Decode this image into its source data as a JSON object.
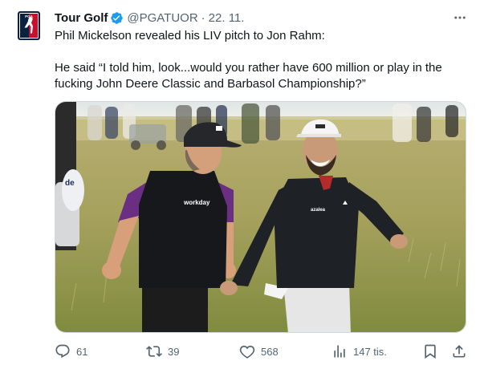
{
  "tweet": {
    "author": {
      "display_name": "Tour Golf",
      "handle": "@PGATUOR",
      "verified": true,
      "avatar_icon": "pga-tour-logo-icon",
      "avatar_text": "PGA TOUR"
    },
    "separator": "·",
    "date": "22. 11.",
    "text_lines": [
      "Phil Mickelson revealed his LIV pitch to Jon Rahm:",
      "He said “I told him, look...would you rather have 600 million or play in the fucking John Deere Classic and Barbasol Championship?”"
    ],
    "media_image_text": {
      "left_vest_logo": "workday",
      "right_jacket_logo": "azalea",
      "bag_text": "de"
    },
    "actions": {
      "reply_count": "61",
      "retweet_count": "39",
      "like_count": "568",
      "views_count": "147 tis."
    }
  },
  "colors": {
    "text_primary": "#0f1419",
    "text_secondary": "#536471",
    "verified_blue": "#1d9bf0",
    "border": "#cfd9de",
    "pga_navy": "#0a2240",
    "pga_red": "#c8102e"
  },
  "icons": {
    "more": "more-dots-icon",
    "verified": "verified-badge-icon",
    "reply": "reply-icon",
    "retweet": "retweet-icon",
    "like": "like-icon",
    "views": "views-icon",
    "bookmark": "bookmark-icon",
    "share": "share-icon"
  }
}
